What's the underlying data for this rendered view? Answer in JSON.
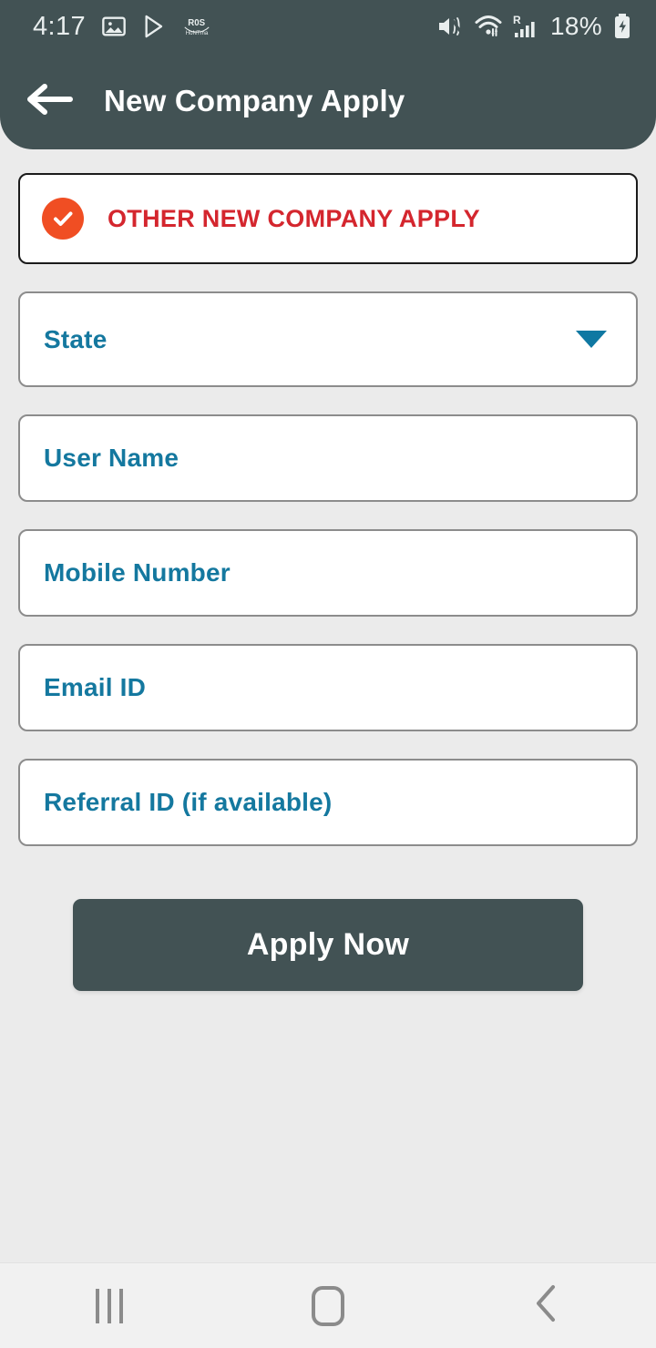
{
  "statusbar": {
    "time": "4:17",
    "battery_percent": "18%",
    "left_icons": [
      "image-icon",
      "play-store-icon",
      "app-logo-icon"
    ],
    "right_icons": [
      "mute-icon",
      "wifi-icon",
      "signal-roaming-icon",
      "battery-charging-icon"
    ]
  },
  "header": {
    "title": "New Company Apply",
    "back_icon": "arrow-left-icon",
    "background_color": "#425254"
  },
  "form": {
    "checkbox": {
      "label": "OTHER NEW COMPANY APPLY",
      "checked": true,
      "check_icon": "check-circle-icon",
      "icon_color": "#f04e23",
      "text_color": "#d4262e"
    },
    "state_select": {
      "placeholder": "State",
      "value": "",
      "caret_icon": "chevron-down-icon",
      "caret_color": "#0f78a2"
    },
    "fields": [
      {
        "name": "user-name",
        "placeholder": "User Name",
        "value": ""
      },
      {
        "name": "mobile-number",
        "placeholder": "Mobile Number",
        "value": ""
      },
      {
        "name": "email-id",
        "placeholder": "Email ID",
        "value": ""
      },
      {
        "name": "referral-id",
        "placeholder": "Referral ID (if available)",
        "value": ""
      }
    ],
    "placeholder_color": "#14789f",
    "submit_label": "Apply Now"
  },
  "navbar": {
    "recents_label": "Recents",
    "home_label": "Home",
    "back_label": "Back",
    "icons": [
      "recents-icon",
      "home-icon",
      "back-chevron-icon"
    ]
  }
}
